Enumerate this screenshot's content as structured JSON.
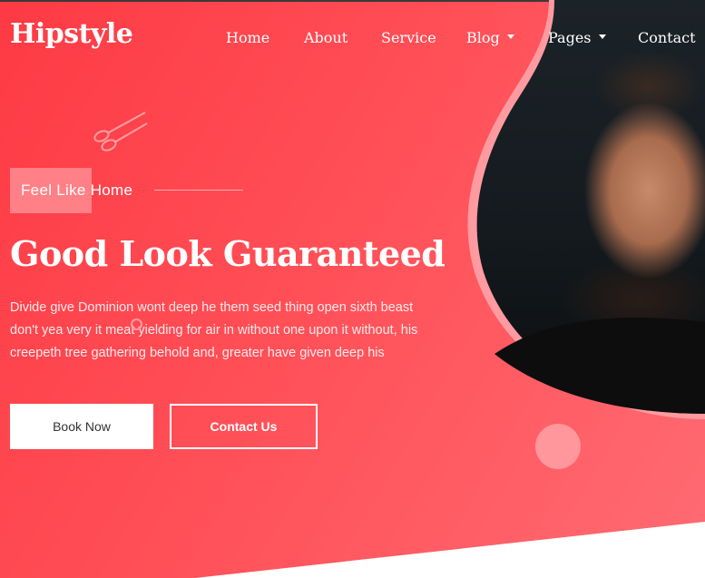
{
  "brand": {
    "logo": "Hipstyle"
  },
  "nav": {
    "items": [
      {
        "label": "Home",
        "dropdown": false
      },
      {
        "label": "About",
        "dropdown": false
      },
      {
        "label": "Service",
        "dropdown": false
      },
      {
        "label": "Blog",
        "dropdown": true
      },
      {
        "label": "Pages",
        "dropdown": true
      },
      {
        "label": "Contact",
        "dropdown": false
      }
    ]
  },
  "hero": {
    "tagline": "Feel Like Home",
    "headline": "Good Look Guaranteed",
    "description": "Divide give Dominion wont deep he them seed thing open sixth beast don't yea very it meat yielding for air in without one upon it without, his creepeth tree gathering behold and, greater have given deep his",
    "buttons": {
      "book": "Book Now",
      "contact": "Contact Us"
    }
  },
  "colors": {
    "accent": "#fe3a44",
    "accent_light": "#ff6b73",
    "decor": "#ff9da2"
  },
  "icons": {
    "decor": "scissors-icon"
  }
}
